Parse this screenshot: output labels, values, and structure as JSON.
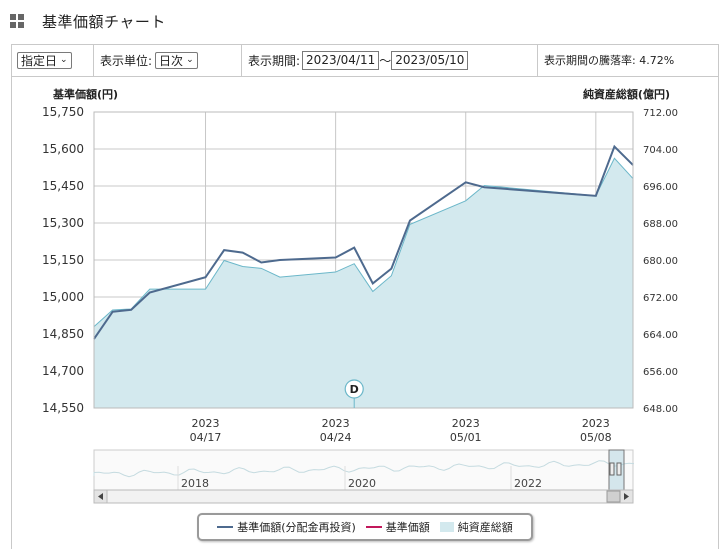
{
  "page": {
    "title": "基準価額チャート"
  },
  "toolbar": {
    "mode_select": "指定日",
    "unit_label": "表示単位:",
    "unit_select": "日次",
    "period_label": "表示期間:",
    "date_from": "2023/04/11",
    "date_sep": "〜",
    "date_to": "2023/05/10",
    "change_text": "表示期間の騰落率: 4.72%"
  },
  "colors": {
    "nav_line": "#4e6a8e",
    "nav_plain": "#c2185b",
    "area_fill": "#d3e9ee",
    "area_line": "#6bb7c9",
    "grid": "#c8c8c8"
  },
  "chart_data": {
    "type": "line",
    "left_axis_label": "基準価額(円)",
    "right_axis_label": "純資産総額(億円)",
    "left_ylim": [
      14550,
      15750
    ],
    "right_ylim": [
      648,
      712
    ],
    "left_ticks": [
      "14,550",
      "14,700",
      "14,850",
      "15,000",
      "15,150",
      "15,300",
      "15,450",
      "15,600",
      "15,750"
    ],
    "right_ticks": [
      "648.00",
      "656.00",
      "664.00",
      "672.00",
      "680.00",
      "688.00",
      "696.00",
      "704.00",
      "712.00"
    ],
    "x_ticks": [
      {
        "date": "2023-04-17",
        "year": "2023",
        "md": "04/17"
      },
      {
        "date": "2023-04-24",
        "year": "2023",
        "md": "04/24"
      },
      {
        "date": "2023-05-01",
        "year": "2023",
        "md": "05/01"
      },
      {
        "date": "2023-05-08",
        "year": "2023",
        "md": "05/08"
      }
    ],
    "x_range": [
      "2023-04-11",
      "2023-05-10"
    ],
    "series": [
      {
        "name": "基準価額(分配金再投資)",
        "x": [
          "2023-04-11",
          "2023-04-12",
          "2023-04-13",
          "2023-04-14",
          "2023-04-17",
          "2023-04-18",
          "2023-04-19",
          "2023-04-20",
          "2023-04-21",
          "2023-04-24",
          "2023-04-25",
          "2023-04-26",
          "2023-04-27",
          "2023-04-28",
          "2023-05-01",
          "2023-05-02",
          "2023-05-08",
          "2023-05-09",
          "2023-05-10"
        ],
        "values": [
          14830,
          14940,
          14948,
          15018,
          15080,
          15190,
          15180,
          15140,
          15150,
          15160,
          15200,
          15055,
          15115,
          15310,
          15465,
          15445,
          15410,
          15610,
          15535
        ]
      },
      {
        "name": "純資産総額",
        "x": [
          "2023-04-11",
          "2023-04-12",
          "2023-04-13",
          "2023-04-14",
          "2023-04-17",
          "2023-04-18",
          "2023-04-19",
          "2023-04-20",
          "2023-04-21",
          "2023-04-24",
          "2023-04-25",
          "2023-04-26",
          "2023-04-27",
          "2023-04-28",
          "2023-05-01",
          "2023-05-02",
          "2023-05-08",
          "2023-05-09",
          "2023-05-10"
        ],
        "values": [
          665.6,
          669.2,
          669.4,
          673.7,
          673.7,
          679.9,
          678.6,
          678.2,
          676.3,
          677.4,
          679.2,
          673.2,
          676.6,
          687.7,
          692.8,
          696.1,
          693.9,
          702.0,
          697.6
        ]
      }
    ],
    "event_marker": {
      "date": "2023-04-25",
      "label": "D"
    },
    "navigator": {
      "years": [
        "2018",
        "2020",
        "2022"
      ]
    }
  },
  "legend": {
    "items": [
      "基準価額(分配金再投資)",
      "基準価額",
      "純資産総額"
    ]
  }
}
